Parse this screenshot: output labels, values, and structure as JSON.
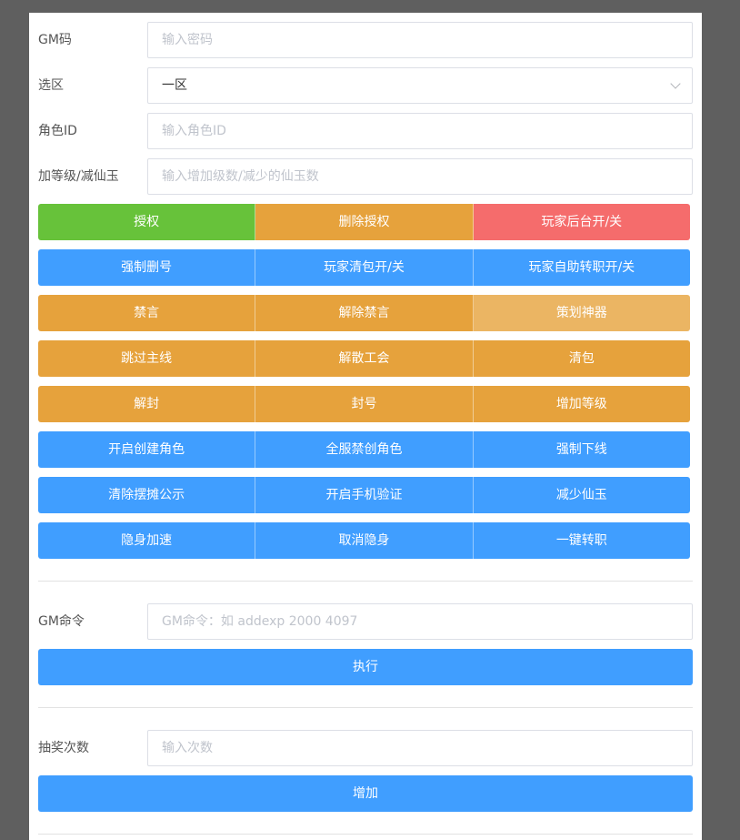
{
  "form": {
    "gm_code": {
      "label": "GM码",
      "placeholder": "输入密码"
    },
    "region": {
      "label": "选区",
      "value": "一区"
    },
    "role_id": {
      "label": "角色ID",
      "placeholder": "输入角色ID"
    },
    "level_jade": {
      "label": "加等级/减仙玉",
      "placeholder": "输入增加级数/减少的仙玉数"
    }
  },
  "colors": {
    "green": "#67c23a",
    "orange": "#e6a23c",
    "orange_light": "#ebb563",
    "red": "#f56c6c",
    "blue": "#409eff"
  },
  "button_rows": [
    [
      {
        "label": "授权",
        "color": "#67c23a"
      },
      {
        "label": "删除授权",
        "color": "#e6a23c"
      },
      {
        "label": "玩家后台开/关",
        "color": "#f56c6c"
      }
    ],
    [
      {
        "label": "强制删号",
        "color": "#409eff"
      },
      {
        "label": "玩家清包开/关",
        "color": "#409eff"
      },
      {
        "label": "玩家自助转职开/关",
        "color": "#409eff"
      }
    ],
    [
      {
        "label": "禁言",
        "color": "#e6a23c"
      },
      {
        "label": "解除禁言",
        "color": "#e6a23c"
      },
      {
        "label": "策划神器",
        "color": "#ebb563"
      }
    ],
    [
      {
        "label": "跳过主线",
        "color": "#e6a23c"
      },
      {
        "label": "解散工会",
        "color": "#e6a23c"
      },
      {
        "label": "清包",
        "color": "#e6a23c"
      }
    ],
    [
      {
        "label": "解封",
        "color": "#e6a23c"
      },
      {
        "label": "封号",
        "color": "#e6a23c"
      },
      {
        "label": "增加等级",
        "color": "#e6a23c"
      }
    ],
    [
      {
        "label": "开启创建角色",
        "color": "#409eff"
      },
      {
        "label": "全服禁创角色",
        "color": "#409eff"
      },
      {
        "label": "强制下线",
        "color": "#409eff"
      }
    ],
    [
      {
        "label": "清除摆摊公示",
        "color": "#409eff"
      },
      {
        "label": "开启手机验证",
        "color": "#409eff"
      },
      {
        "label": "减少仙玉",
        "color": "#409eff"
      }
    ],
    [
      {
        "label": "隐身加速",
        "color": "#409eff"
      },
      {
        "label": "取消隐身",
        "color": "#409eff"
      },
      {
        "label": "一键转职",
        "color": "#409eff"
      }
    ]
  ],
  "gm_command": {
    "label": "GM命令",
    "placeholder": "GM命令：如 addexp 2000 4097",
    "button_label": "执行"
  },
  "lottery": {
    "label": "抽奖次数",
    "placeholder": "输入次数",
    "button_label": "增加"
  }
}
